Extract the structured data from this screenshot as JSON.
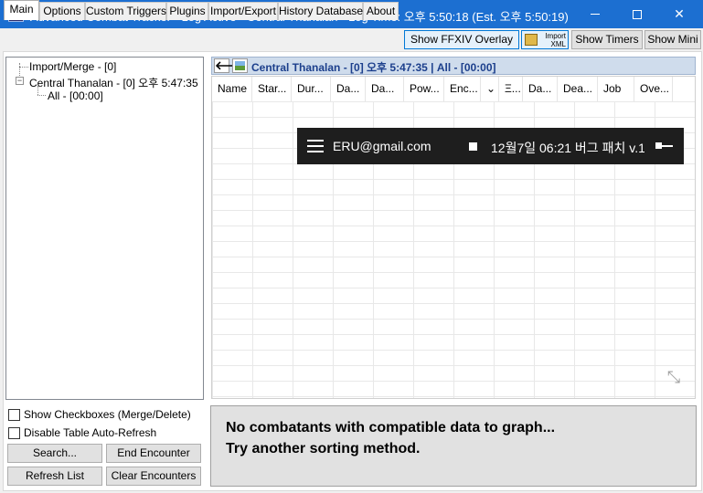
{
  "window": {
    "title": "Advanced Combat Tracker - Log Active - Central Thanalan - Log Time: 오후 5:50:18 (Est. 오후 5:50:19)",
    "controls": {
      "minimize": "minimize",
      "maximize": "maximize",
      "close": "✕"
    }
  },
  "tabs": [
    "Main",
    "Options",
    "Custom Triggers",
    "Plugins",
    "Import/Export",
    "History Database",
    "About"
  ],
  "active_tab": "Main",
  "toolbar": {
    "show_ffxiv_overlay": "Show FFXIV Overlay",
    "import_xml_line1": "Import",
    "import_xml_line2": "XML",
    "show_timers": "Show Timers",
    "show_mini": "Show Mini"
  },
  "tree": {
    "root_merge": "Import/Merge - [0]",
    "zone": "Central Thanalan - [0] 오후 5:47:35",
    "zone_expander": "−",
    "encounter": "All - [00:00]"
  },
  "options": {
    "show_checkboxes": "Show Checkboxes (Merge/Delete)",
    "disable_auto_refresh": "Disable Table Auto-Refresh"
  },
  "buttons": {
    "search": "Search...",
    "end_encounter": "End Encounter",
    "refresh_list": "Refresh List",
    "clear_encounters": "Clear Encounters"
  },
  "encounter_header": {
    "back_glyph": "🡐",
    "title": "Central Thanalan - [0] 오후 5:47:35  |  All - [00:00]"
  },
  "table": {
    "columns": [
      "Name",
      "Star...",
      "Dur...",
      "Da...",
      "Da...",
      "Pow...",
      "Enc...",
      "⌄",
      "Ξ...",
      "Da...",
      "Dea...",
      "Job",
      "Ove..."
    ]
  },
  "overlay_bar": {
    "email": "ERU@gmail.com",
    "text": "12월7일 06:21 버그 패치 v.1."
  },
  "graph": {
    "line1": "No combatants with compatible data to graph...",
    "line2": "Try another sorting method."
  }
}
